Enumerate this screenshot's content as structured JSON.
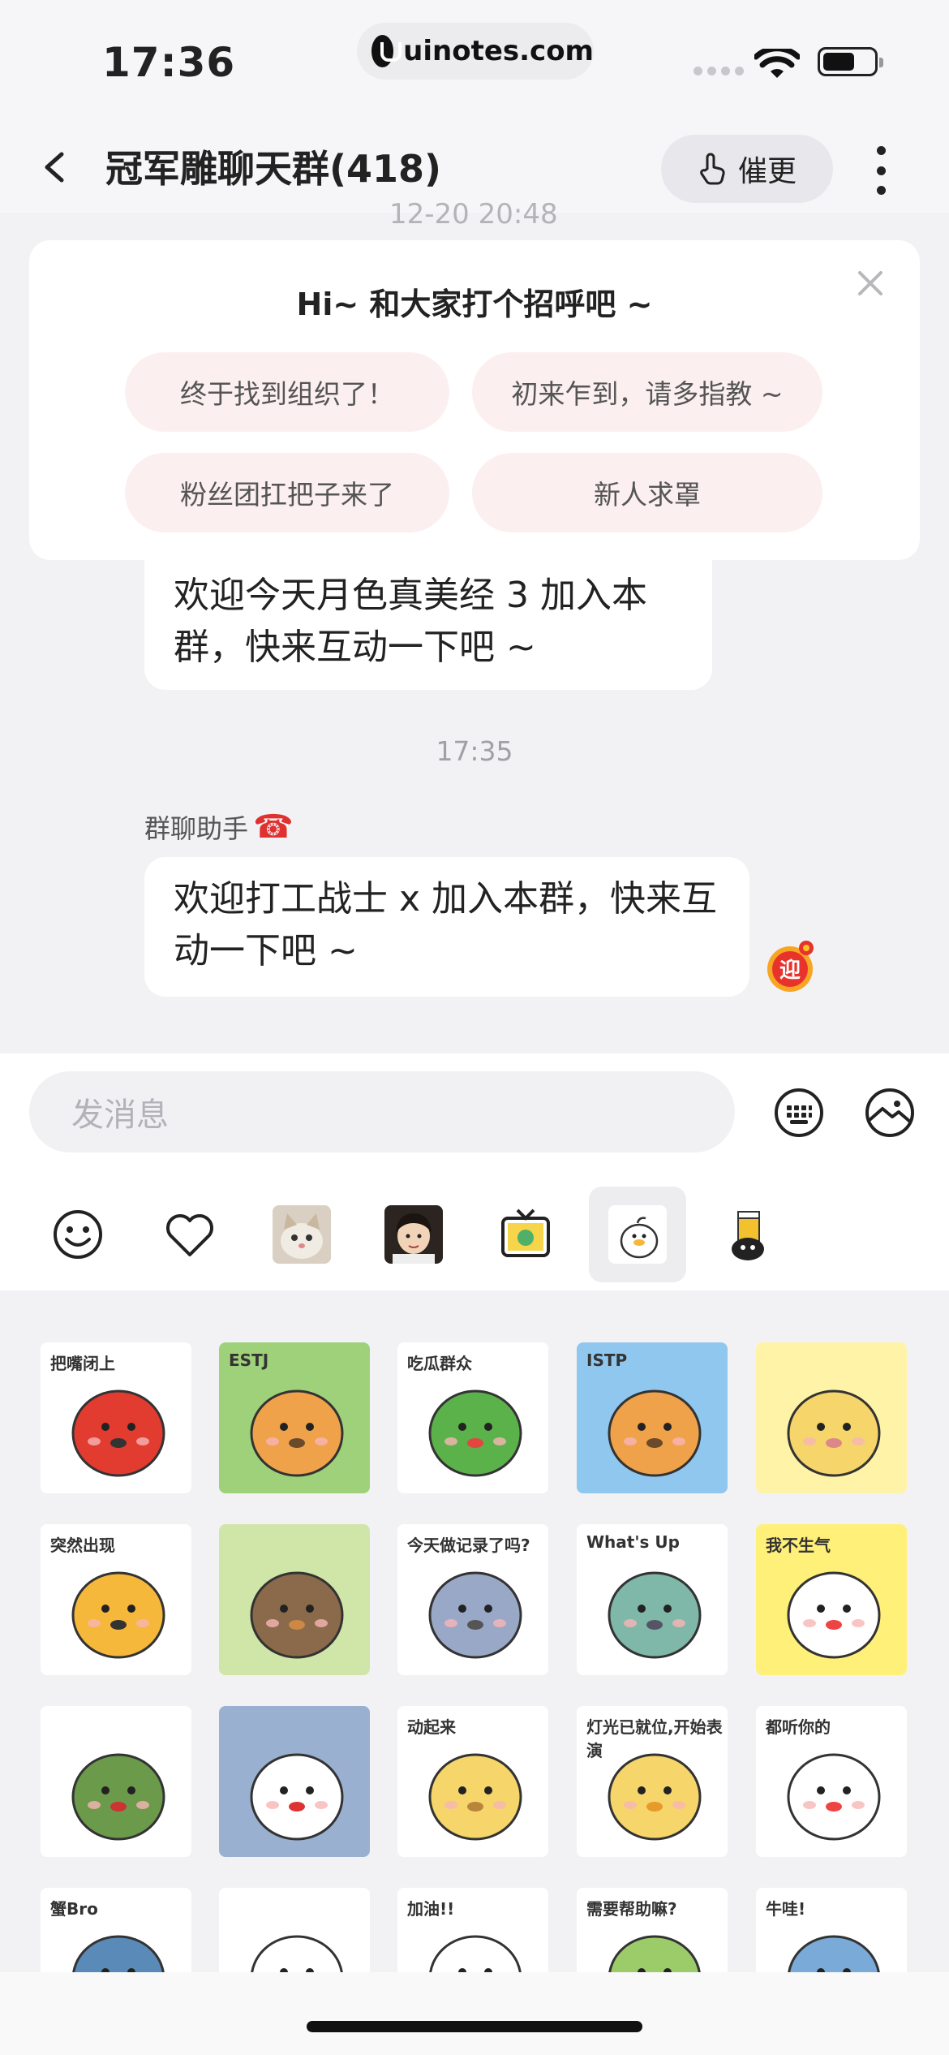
{
  "status_bar": {
    "time": "17:36",
    "url": "uinotes.com"
  },
  "nav": {
    "title": "冠军雕聊天群(418)",
    "urge_label": "催更"
  },
  "chat": {
    "partial_timestamp": "12-20 20:48",
    "greeting": {
      "title": "Hi~ 和大家打个招呼吧 ~",
      "chips": [
        "终于找到组织了！",
        "初来乍到，请多指教 ~",
        "粉丝团扛把子来了",
        "新人求罩"
      ]
    },
    "messages": [
      {
        "text": "欢迎今天月色真美经 3 加入本群，快来互动一下吧 ~"
      },
      {
        "time": "17:35"
      },
      {
        "sender": "群聊助手",
        "text": "欢迎打工战士 x 加入本群，快来互动一下吧 ~"
      }
    ],
    "welcome_badge": "迎"
  },
  "input": {
    "placeholder": "发消息"
  },
  "sticker_tabs": [
    {
      "icon": "smiley-icon"
    },
    {
      "icon": "heart-icon"
    },
    {
      "icon": "cat-photo"
    },
    {
      "icon": "child-photo"
    },
    {
      "icon": "tv-sticker"
    },
    {
      "icon": "duck-sticker",
      "active": true
    },
    {
      "icon": "beer-sticker"
    }
  ],
  "stickers": [
    {
      "caption": "把嘴闭上"
    },
    {
      "caption": "ESTJ"
    },
    {
      "caption": "吃瓜群众"
    },
    {
      "caption": "ISTP"
    },
    {
      "caption": ""
    },
    {
      "caption": "突然出现"
    },
    {
      "caption": ""
    },
    {
      "caption": "今天做记录了吗?"
    },
    {
      "caption": "What's Up"
    },
    {
      "caption": "我不生气"
    },
    {
      "caption": ""
    },
    {
      "caption": ""
    },
    {
      "caption": "动起来"
    },
    {
      "caption": "灯光已就位,开始表演"
    },
    {
      "caption": "都听你的"
    },
    {
      "caption": "蟹Bro"
    },
    {
      "caption": ""
    },
    {
      "caption": "加油!!"
    },
    {
      "caption": "需要帮助嘛?"
    },
    {
      "caption": "牛哇!"
    }
  ],
  "colors": {
    "accent_red": "#e0312f",
    "chip_bg": "#fcefef",
    "bg": "#f2f2f5"
  }
}
